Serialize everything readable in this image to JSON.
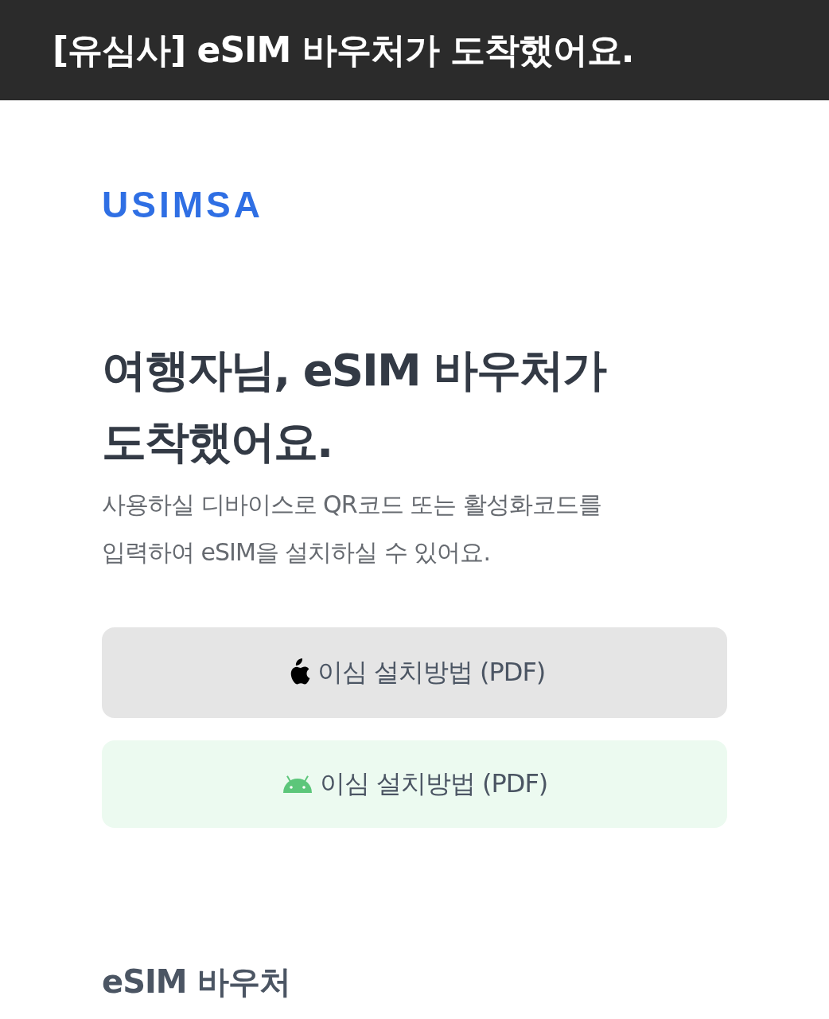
{
  "header": {
    "title": "[유심사] eSIM 바우처가 도착했어요."
  },
  "logo": {
    "text": "USIMSA"
  },
  "headline": {
    "lines": [
      "여행자님, eSIM 바우처가",
      "도착했어요."
    ]
  },
  "description": {
    "lines": [
      "사용하실 디바이스로 QR코드 또는 활성화코드를",
      "입력하여 eSIM을 설치하실 수 있어요."
    ]
  },
  "buttons": [
    {
      "kind": "apple",
      "label": "이심 설치방법 (PDF)"
    },
    {
      "kind": "android",
      "label": "이심 설치방법 (PDF)"
    }
  ],
  "section": {
    "title": "eSIM 바우처"
  }
}
